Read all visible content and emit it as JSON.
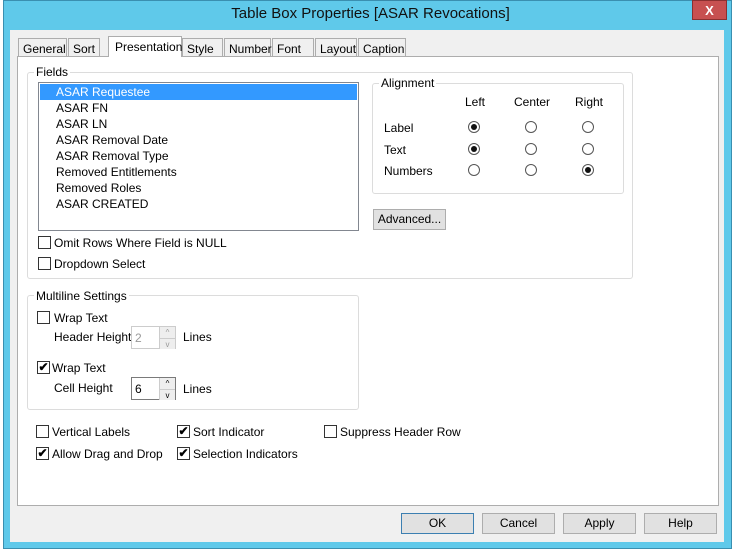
{
  "window": {
    "title": "Table Box Properties [ASAR Revocations]",
    "close_label": "X"
  },
  "tabs": [
    "General",
    "Sort",
    "Presentation",
    "Style",
    "Number",
    "Font",
    "Layout",
    "Caption"
  ],
  "selected_tab": "Presentation",
  "fields": {
    "label": "Fields",
    "items": [
      "ASAR Requestee",
      "ASAR FN",
      "ASAR LN",
      "ASAR Removal Date",
      "ASAR Removal Type",
      "Removed Entitlements",
      "Removed Roles",
      "ASAR CREATED"
    ],
    "selected": "ASAR Requestee",
    "omit_null": {
      "label": "Omit Rows Where Field is NULL",
      "checked": false
    },
    "dropdown_select": {
      "label": "Dropdown Select",
      "checked": false
    }
  },
  "alignment": {
    "label": "Alignment",
    "columns": [
      "Left",
      "Center",
      "Right"
    ],
    "rows": [
      {
        "label": "Label",
        "value": "Left"
      },
      {
        "label": "Text",
        "value": "Left"
      },
      {
        "label": "Numbers",
        "value": "Right"
      }
    ]
  },
  "advanced_label": "Advanced...",
  "multiline": {
    "label": "Multiline Settings",
    "header": {
      "wrap_label": "Wrap Text",
      "checked": false,
      "height_label": "Header Height",
      "value": "2",
      "unit": "Lines"
    },
    "cell": {
      "wrap_label": "Wrap Text",
      "checked": true,
      "height_label": "Cell Height",
      "value": "6",
      "unit": "Lines"
    }
  },
  "options": [
    {
      "label": "Vertical Labels",
      "checked": false
    },
    {
      "label": "Sort Indicator",
      "checked": true
    },
    {
      "label": "Suppress Header Row",
      "checked": false
    },
    {
      "label": "Allow Drag and Drop",
      "checked": true
    },
    {
      "label": "Selection Indicators",
      "checked": true
    }
  ],
  "buttons": {
    "ok": "OK",
    "cancel": "Cancel",
    "apply": "Apply",
    "help": "Help"
  },
  "colors": {
    "title_bar": "#5fc9ea",
    "selection": "#3399ff",
    "close": "#c75050"
  }
}
